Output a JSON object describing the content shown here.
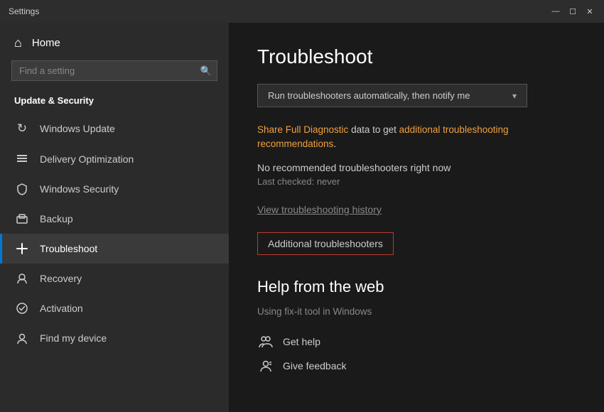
{
  "titlebar": {
    "title": "Settings",
    "minimize": "—",
    "maximize": "☐",
    "close": "✕"
  },
  "sidebar": {
    "home_label": "Home",
    "search_placeholder": "Find a setting",
    "section_title": "Update & Security",
    "items": [
      {
        "id": "windows-update",
        "label": "Windows Update",
        "icon": "↻"
      },
      {
        "id": "delivery-optimization",
        "label": "Delivery Optimization",
        "icon": "↑"
      },
      {
        "id": "windows-security",
        "label": "Windows Security",
        "icon": "🛡"
      },
      {
        "id": "backup",
        "label": "Backup",
        "icon": "↑"
      },
      {
        "id": "troubleshoot",
        "label": "Troubleshoot",
        "icon": "↕"
      },
      {
        "id": "recovery",
        "label": "Recovery",
        "icon": "👤"
      },
      {
        "id": "activation",
        "label": "Activation",
        "icon": "✓"
      },
      {
        "id": "find-my-device",
        "label": "Find my device",
        "icon": "👤"
      }
    ]
  },
  "main": {
    "page_title": "Troubleshoot",
    "dropdown_label": "Run troubleshooters automatically, then notify me",
    "diagnostic_text_pre": "Share Full Diagnostic",
    "diagnostic_link": "Share Full Diagnostic",
    "diagnostic_text_post": " data to get additional troubleshooting recommendations.",
    "no_troubleshooters": "No recommended troubleshooters right now",
    "last_checked_label": "Last checked: never",
    "history_link": "View troubleshooting history",
    "additional_btn": "Additional troubleshooters",
    "help_section_title": "Help from the web",
    "help_desc": "Using fix-it tool in Windows",
    "help_items": [
      {
        "id": "get-help",
        "label": "Get help",
        "icon": "👥"
      },
      {
        "id": "give-feedback",
        "label": "Give feedback",
        "icon": "👤"
      }
    ]
  }
}
